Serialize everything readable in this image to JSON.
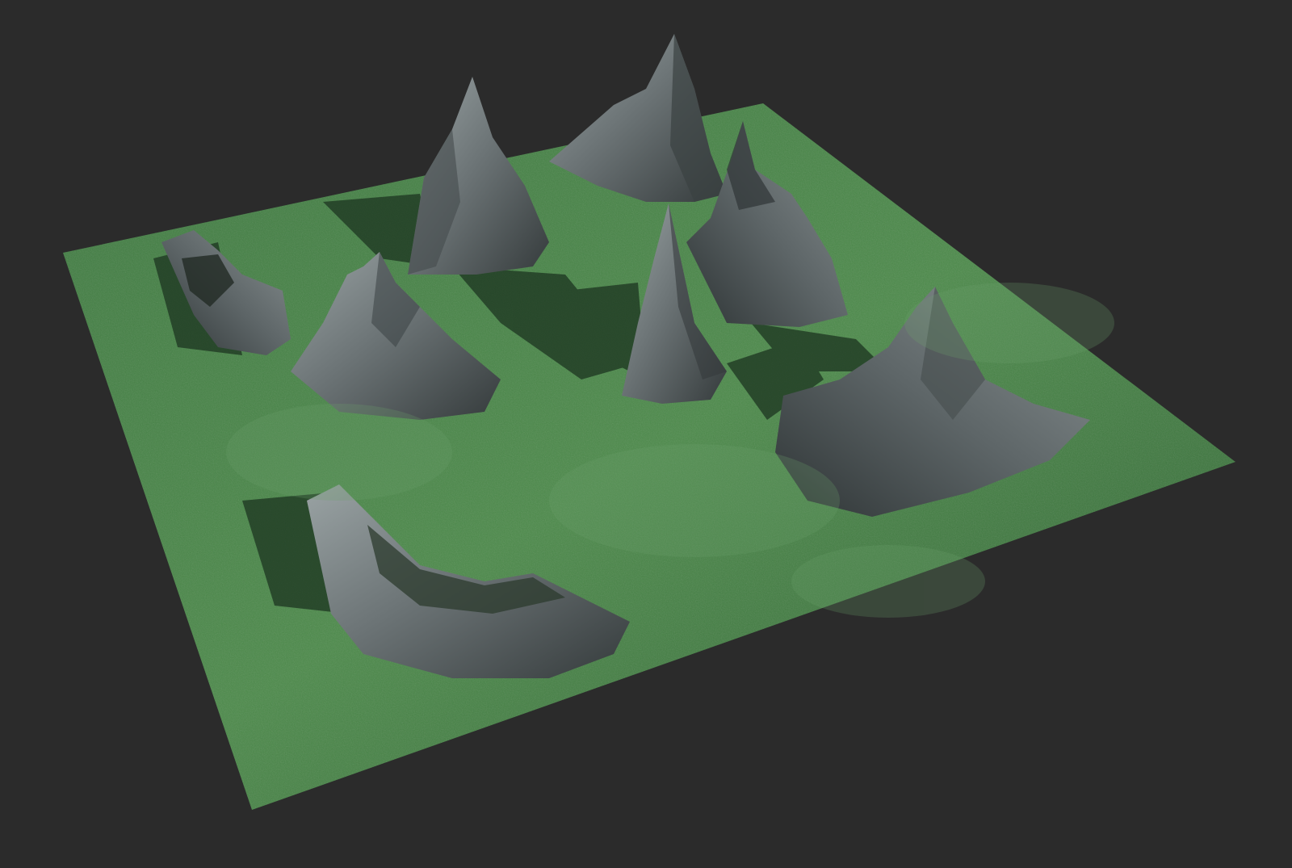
{
  "scene": {
    "background_color": "#2b2b2b",
    "terrain": {
      "grass_color_light": "#4f8a4d",
      "grass_color_mid": "#3c6e3d",
      "grass_color_dark": "#234827",
      "rock_color_light": "#8d9698",
      "rock_color_mid": "#5c6466",
      "rock_color_dark": "#2f3536",
      "shadow_color": "#1a2a1d"
    },
    "objects": [
      {
        "name": "terrain-plane"
      },
      {
        "name": "mountain-peak-center-top"
      },
      {
        "name": "mountain-peak-top-left"
      },
      {
        "name": "mountain-ridge-right"
      },
      {
        "name": "mountain-spire-center"
      },
      {
        "name": "mountain-peak-right"
      },
      {
        "name": "mountain-peak-left-middle"
      },
      {
        "name": "mountain-crater-left"
      },
      {
        "name": "mountain-crater-bottom"
      }
    ]
  }
}
